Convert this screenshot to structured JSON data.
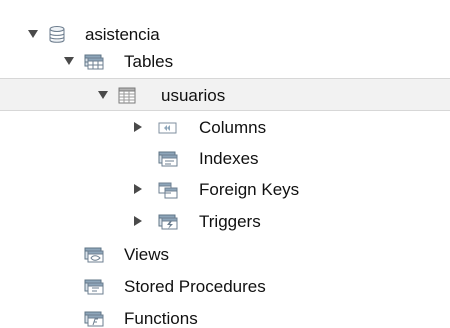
{
  "tree": {
    "schema": {
      "label": "asistencia",
      "icon": "database-icon",
      "expanded": true
    },
    "tables_group": {
      "label": "Tables",
      "icon": "tables-folder-icon",
      "expanded": true
    },
    "table": {
      "label": "usuarios",
      "icon": "table-grid-icon",
      "expanded": true,
      "selected": true
    },
    "table_children": [
      {
        "label": "Columns",
        "icon": "columns-icon",
        "expandable": true,
        "expanded": false
      },
      {
        "label": "Indexes",
        "icon": "indexes-icon",
        "expandable": false,
        "expanded": false
      },
      {
        "label": "Foreign Keys",
        "icon": "foreign-keys-icon",
        "expandable": true,
        "expanded": false
      },
      {
        "label": "Triggers",
        "icon": "triggers-icon",
        "expandable": true,
        "expanded": false
      }
    ],
    "other_groups": [
      {
        "label": "Views",
        "icon": "views-folder-icon"
      },
      {
        "label": "Stored Procedures",
        "icon": "stored-procedures-folder-icon"
      },
      {
        "label": "Functions",
        "icon": "functions-folder-icon"
      }
    ],
    "colors": {
      "selected_row_bg": "#f2f2f2",
      "selected_row_border": "#d7d7d7",
      "caret": "#4a4a4a",
      "icon_blue": "#6d8aa8",
      "icon_gray": "#808080"
    }
  }
}
